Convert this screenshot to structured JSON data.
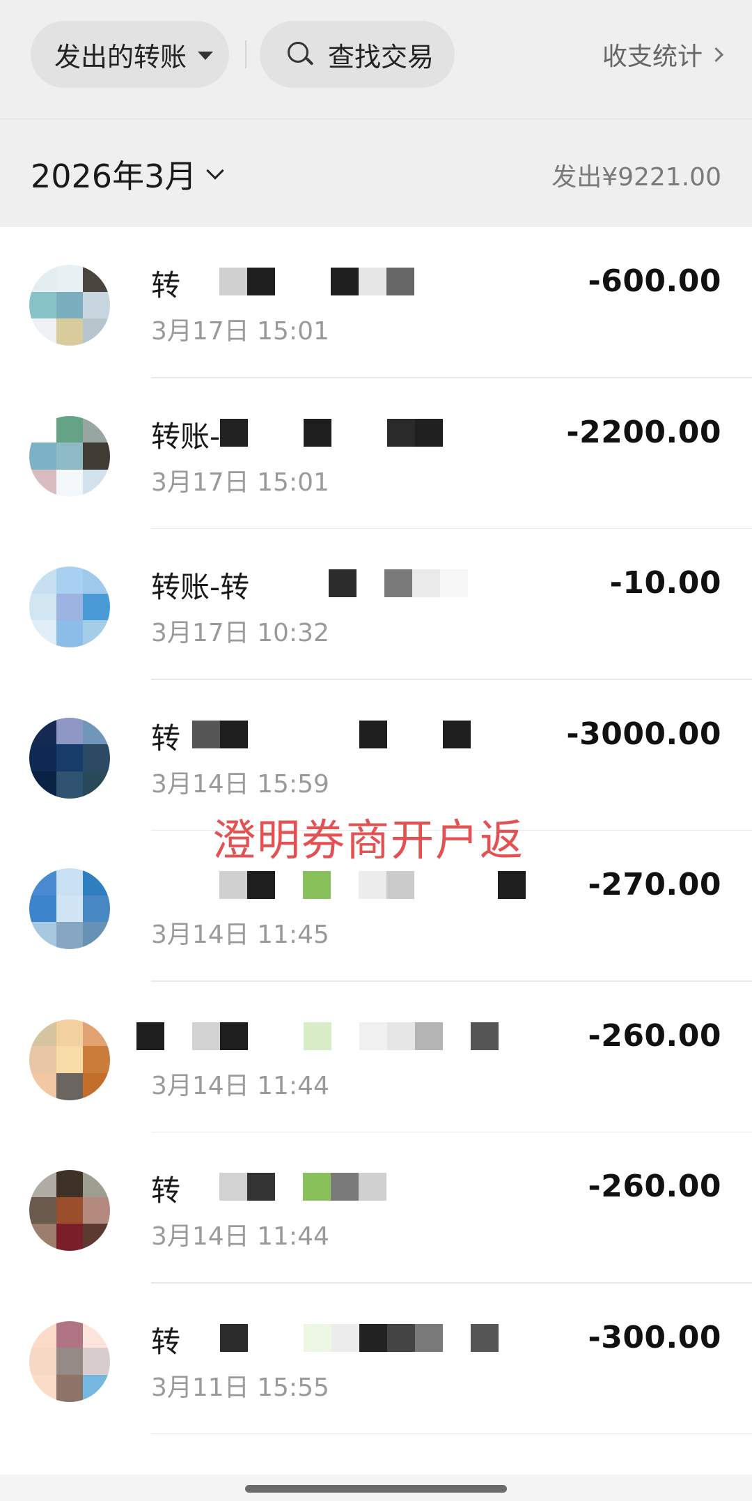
{
  "header": {
    "filter_label": "发出的转账",
    "search_label": "查找交易",
    "stats_label": "收支统计"
  },
  "month_bar": {
    "month_label": "2026年3月",
    "total_label": "发出¥9221.00"
  },
  "transactions": [
    {
      "title": "转",
      "time": "3月17日 15:01",
      "amount": "-600.00",
      "avatar": [
        "#e4eef0",
        "#e8f0f4",
        "#4b4540",
        "#86c2c6",
        "#7aaebe",
        "#c8d6e0",
        "#eef2f4",
        "#d8cc9c",
        "#b6c6cc"
      ],
      "redact": [
        [
          "#cfcfcf",
          "#1e1e1e",
          "#ffffff",
          "#ffffff",
          "#1e1e1e",
          "#e6e6e6",
          "#666666"
        ],
        315
      ]
    },
    {
      "title": "转账-",
      "time": "3月17日 15:01",
      "amount": "-2200.00",
      "avatar": [
        "#ffffff",
        "#64a484",
        "#98a6a2",
        "#7cb2c6",
        "#8ebac6",
        "#403c34",
        "#d8bcc0",
        "#f4f8fb",
        "#d2e2ec"
      ],
      "redact": [
        [
          "#222222",
          "#ffffff",
          "#ffffff",
          "#1e1e1e",
          "#ffffff",
          "#ffffff",
          "#2a2a2a",
          "#202020"
        ],
        316
      ]
    },
    {
      "title": "转账-转",
      "time": "3月17日 10:32",
      "amount": "-10.00",
      "avatar": [
        "#c6e0f2",
        "#a8d0f2",
        "#9ec8ec",
        "#d2e6f2",
        "#9cb2e0",
        "#4a9ad6",
        "#e0eef8",
        "#8cbce8",
        "#a4cee8"
      ],
      "redact": [
        [
          "#2c2c2c",
          "#ffffff",
          "#7a7a7a",
          "#eaeaea",
          "#f6f6f6"
        ],
        472
      ]
    },
    {
      "title": "转",
      "time": "3月14日 15:59",
      "amount": "-3000.00",
      "avatar": [
        "#142a52",
        "#8e96c4",
        "#7096bc",
        "#0e2a52",
        "#183c6a",
        "#2c4a64",
        "#0a2244",
        "#2e5270",
        "#284a58"
      ],
      "redact": [
        [
          "#555555",
          "#1e1e1e",
          "#ffffff",
          "#ffffff",
          "#ffffff",
          "#ffffff",
          "#1e1e1e",
          "#ffffff",
          "#ffffff",
          "#1e1e1e"
        ],
        276
      ]
    },
    {
      "title": "",
      "time": "3月14日 11:45",
      "amount": "-270.00",
      "avatar": [
        "#4a8ad0",
        "#c8e0f2",
        "#2e7ec0",
        "#3c84cc",
        "#d0e4f4",
        "#4888c2",
        "#a8c8e0",
        "#86a6c4",
        "#6692b6"
      ],
      "redact": [
        [
          "#d0d0d0",
          "#1e1e1e",
          "#ffffff",
          "#88c05a",
          "#ffffff",
          "#ececec",
          "#cbcbcb",
          "#ffffff",
          "#ffffff",
          "#ffffff",
          "#1e1e1e"
        ],
        315
      ]
    },
    {
      "title": "",
      "time": "3月14日 11:44",
      "amount": "-260.00",
      "avatar": [
        "#d6c4a0",
        "#f2d0a0",
        "#e2a272",
        "#e8c8a4",
        "#f8dca8",
        "#cc7c3a",
        "#f2c8a4",
        "#6a6560",
        "#c46e2c"
      ],
      "redact": [
        [
          "#1e1e1e",
          "#ffffff",
          "#d2d2d2",
          "#1e1e1e",
          "#ffffff",
          "#ffffff",
          "#d8ecc8",
          "#ffffff",
          "#f0f0f0",
          "#e6e6e6",
          "#b4b4b4",
          "#ffffff",
          "#555555"
        ],
        196
      ]
    },
    {
      "title": "转",
      "time": "3月14日 11:44",
      "amount": "-260.00",
      "avatar": [
        "#b0aca4",
        "#3e3226",
        "#9e9e90",
        "#6a5a4c",
        "#9a4e2c",
        "#b48a7e",
        "#9c7e6c",
        "#7a1e2a",
        "#5c3a32"
      ],
      "redact": [
        [
          "#d2d2d2",
          "#333333",
          "#ffffff",
          "#88c05a",
          "#7a7a7a",
          "#d0d0d0"
        ],
        315
      ]
    },
    {
      "title": "转",
      "time": "3月11日 15:55",
      "amount": "-300.00",
      "avatar": [
        "#fcdcc8",
        "#b07484",
        "#fce4dc",
        "#f6d8c4",
        "#968a86",
        "#d8cccc",
        "#fadcc8",
        "#8e7468",
        "#74b8e0"
      ],
      "redact": [
        [
          "#ffffff",
          "#2c2c2c",
          "#ffffff",
          "#ffffff",
          "#eef6e4",
          "#ececec",
          "#222222",
          "#444444",
          "#7a7a7a",
          "#ffffff",
          "#555555"
        ],
        276
      ]
    }
  ],
  "watermark": "澄明券商开户返"
}
